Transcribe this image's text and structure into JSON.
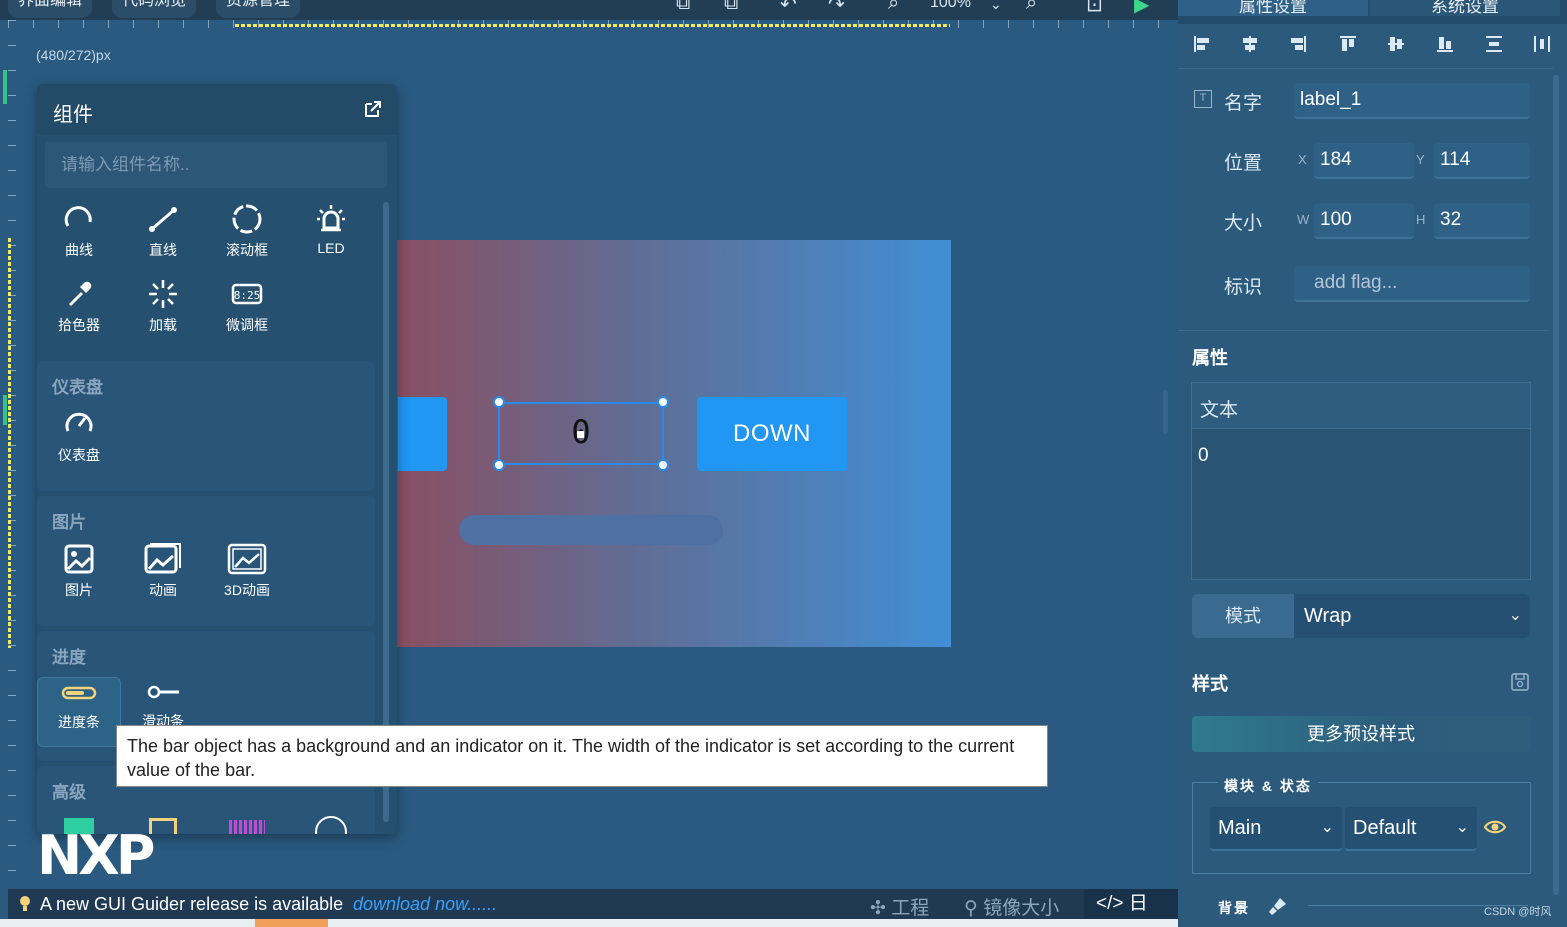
{
  "top_tabs": [
    "界面编辑",
    "代码浏览",
    "资源管理"
  ],
  "zoom_level": "100%",
  "screen_size": "(480/272)px",
  "canvas": {
    "down_button_label": "DOWN",
    "label_text": "0",
    "colors": {
      "gradient_left": "#8a4f62",
      "gradient_right": "#418fd6",
      "button": "#2196f3",
      "selection": "#2a8ae8"
    }
  },
  "components_panel": {
    "title": "组件",
    "search_placeholder": "请输入组件名称..",
    "basic_items": [
      "曲线",
      "直线",
      "滚动框",
      "LED",
      "拾色器",
      "加载",
      "微调框"
    ],
    "sections": [
      {
        "title": "仪表盘",
        "items": [
          "仪表盘"
        ]
      },
      {
        "title": "图片",
        "items": [
          "图片",
          "动画",
          "3D动画"
        ]
      },
      {
        "title": "进度",
        "items": [
          "进度条",
          "滑动条"
        ]
      },
      {
        "title": "高级",
        "items": []
      }
    ]
  },
  "logo_text": "NXP",
  "tooltip": "The bar object has a background and an indicator on it. The width of the indicator is set according to the current value of the bar.",
  "status_bar": {
    "update_text": "A new GUI Guider release is available",
    "update_link": "download now......",
    "items": [
      "工程",
      "镜像大小",
      "日志"
    ]
  },
  "right_panel": {
    "tabs": [
      "属性设置",
      "系统设置"
    ],
    "name_label": "名字",
    "name_value": "label_1",
    "position_label": "位置",
    "pos_x_axis": "X",
    "pos_x": "184",
    "pos_y_axis": "Y",
    "pos_y": "114",
    "size_label": "大小",
    "size_w_axis": "W",
    "size_w": "100",
    "size_h_axis": "H",
    "size_h": "32",
    "flag_label": "标识",
    "flag_placeholder": "add flag...",
    "properties_title": "属性",
    "text_label": "文本",
    "text_value": "0",
    "mode_label": "模式",
    "mode_value": "Wrap",
    "style_title": "样式",
    "more_styles": "更多预设样式",
    "module_state_label": "模块 & 状态",
    "module_value": "Main",
    "state_value": "Default",
    "background_label": "背景"
  },
  "watermark": "CSDN @时风"
}
